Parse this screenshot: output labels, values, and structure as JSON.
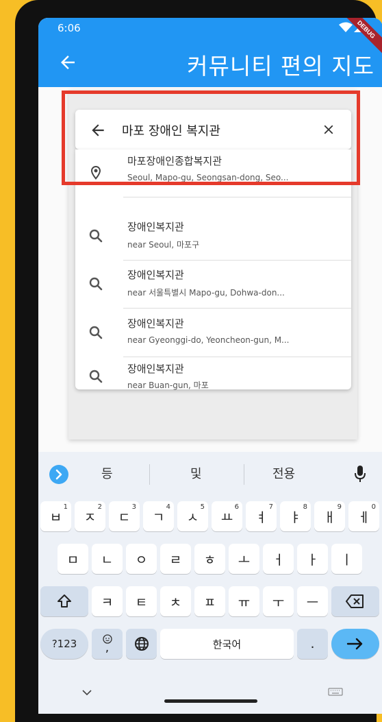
{
  "status": {
    "time": "6:06",
    "debug_banner": "DEBUG"
  },
  "appbar": {
    "title": "커뮤니티 편의 지도"
  },
  "search": {
    "value": "마포 장애인 복지관"
  },
  "results": [
    {
      "icon": "place-icon",
      "title": "마포장애인종합복지관",
      "subtitle": "Seoul, Mapo-gu, Seongsan-dong, Seo..."
    },
    {
      "icon": "search-icon",
      "title": "장애인복지관",
      "subtitle": "near Seoul, 마포구"
    },
    {
      "icon": "search-icon",
      "title": "장애인복지관",
      "subtitle": "near 서울특별시 Mapo-gu, Dohwa-don..."
    },
    {
      "icon": "search-icon",
      "title": "장애인복지관",
      "subtitle": "near Gyeonggi-do, Yeoncheon-gun, M..."
    },
    {
      "icon": "search-icon",
      "title": "장애인복지관",
      "subtitle": "near Buan-gun, 마포"
    }
  ],
  "keyboard": {
    "suggestions": [
      "등",
      "및",
      "전용"
    ],
    "row1": [
      {
        "k": "ㅂ",
        "n": "1"
      },
      {
        "k": "ㅈ",
        "n": "2"
      },
      {
        "k": "ㄷ",
        "n": "3"
      },
      {
        "k": "ㄱ",
        "n": "4"
      },
      {
        "k": "ㅅ",
        "n": "5"
      },
      {
        "k": "ㅛ",
        "n": "6"
      },
      {
        "k": "ㅕ",
        "n": "7"
      },
      {
        "k": "ㅑ",
        "n": "8"
      },
      {
        "k": "ㅐ",
        "n": "9"
      },
      {
        "k": "ㅔ",
        "n": "0"
      }
    ],
    "row2": [
      "ㅁ",
      "ㄴ",
      "ㅇ",
      "ㄹ",
      "ㅎ",
      "ㅗ",
      "ㅓ",
      "ㅏ",
      "ㅣ"
    ],
    "row3": [
      "ㅋ",
      "ㅌ",
      "ㅊ",
      "ㅍ",
      "ㅠ",
      "ㅜ",
      "ㅡ"
    ],
    "symbols_label": "?123",
    "comma_label": ",",
    "space_label": "한국어",
    "period_label": "."
  }
}
